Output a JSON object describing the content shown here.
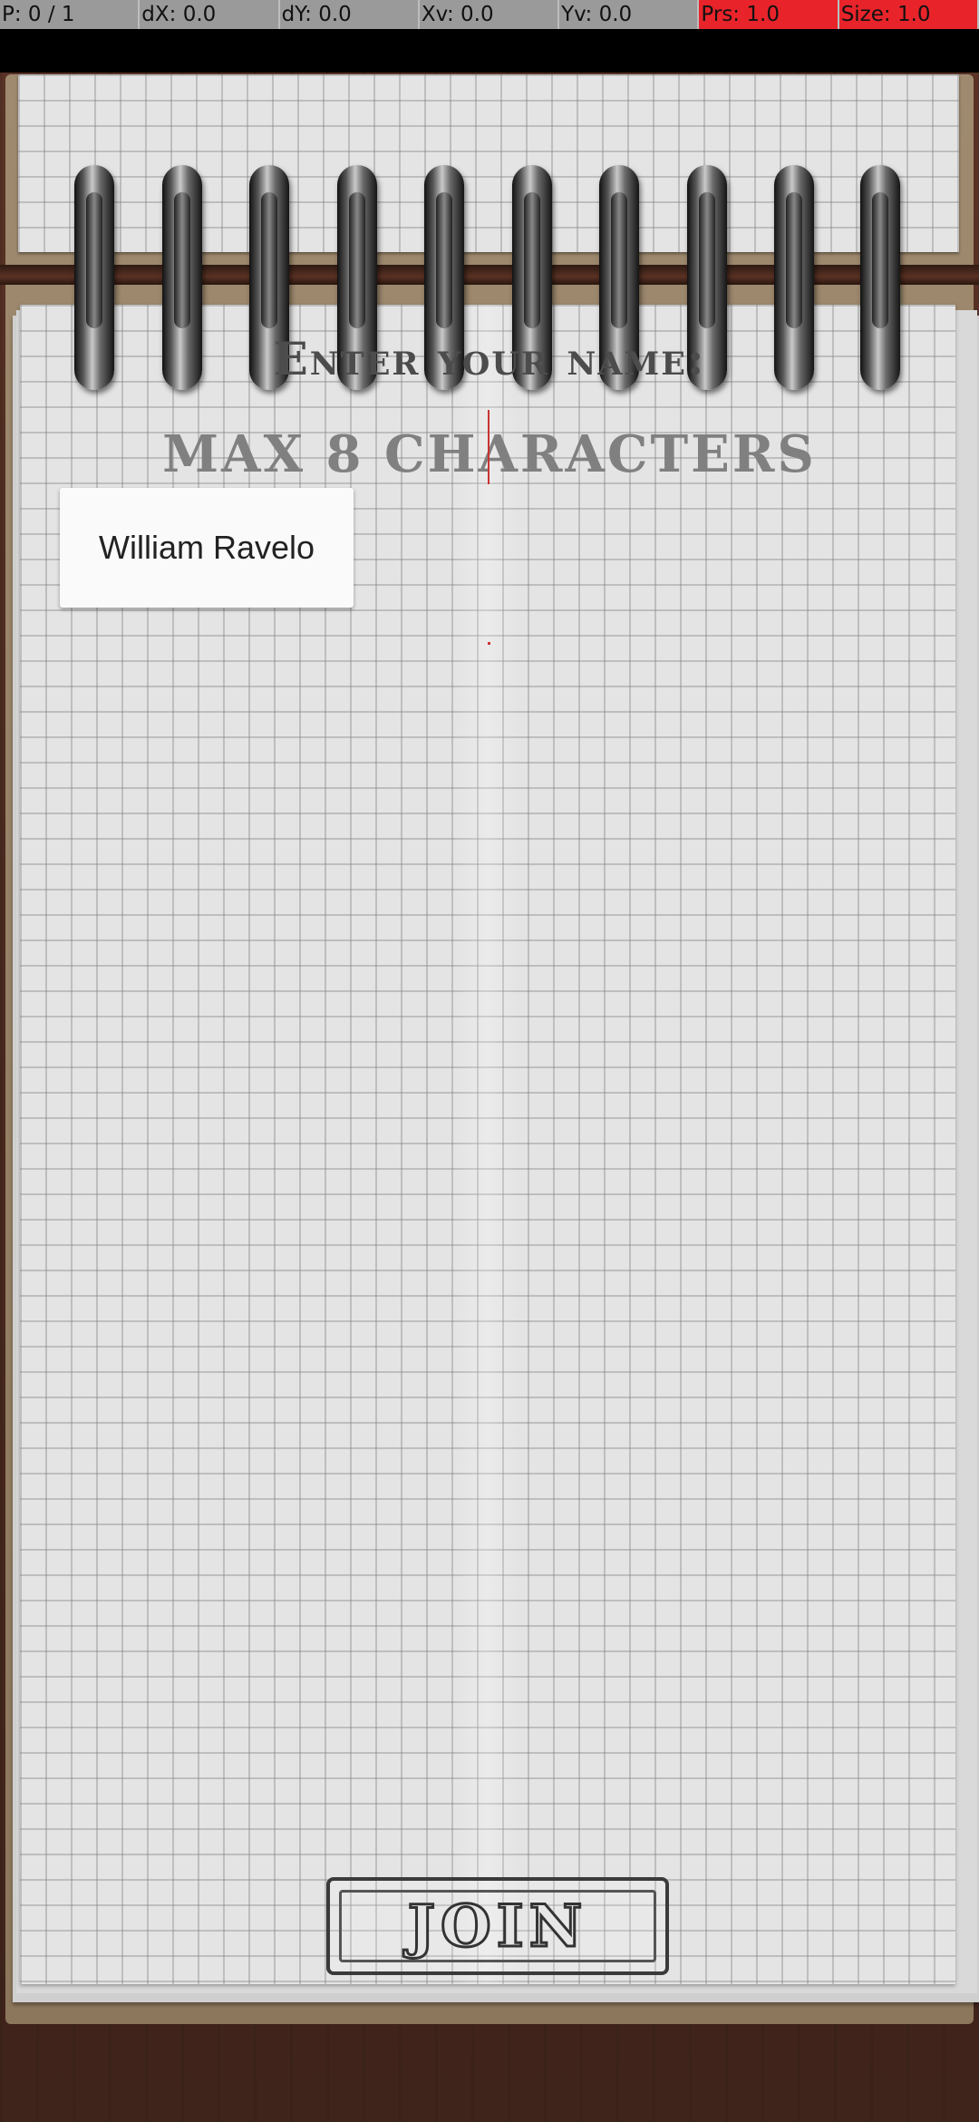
{
  "debug_bar": {
    "pointer": "P: 0 / 1",
    "dx": "dX: 0.0",
    "dy": "dY: 0.0",
    "xv": "Xv: 0.0",
    "yv": "Yv: 0.0",
    "prs": "Prs: 1.0",
    "size": "Size: 1.0",
    "highlight_color": "#e8242a"
  },
  "form": {
    "heading": "Enter your name:",
    "hint": "MAX 8 CHARACTERS",
    "name_value": "William Ravelo"
  },
  "join_button": {
    "label": "JOIN"
  },
  "notebook": {
    "ring_count": 10
  }
}
